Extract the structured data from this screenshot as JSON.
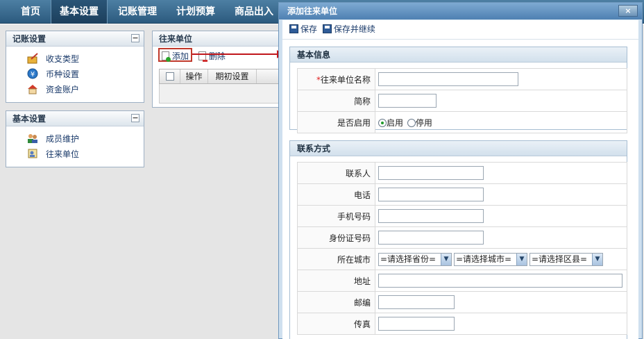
{
  "nav": {
    "tabs": [
      {
        "label": "首页"
      },
      {
        "label": "基本设置"
      },
      {
        "label": "记账管理"
      },
      {
        "label": "计划预算"
      },
      {
        "label": "商品出入"
      }
    ]
  },
  "sidebar": {
    "bookkeeping": {
      "title": "记账设置",
      "items": [
        {
          "label": "收支类型"
        },
        {
          "label": "币种设置"
        },
        {
          "label": "资金账户"
        }
      ]
    },
    "basic": {
      "title": "基本设置",
      "items": [
        {
          "label": "成员维护"
        },
        {
          "label": "往来单位"
        }
      ]
    },
    "collapse_label": "−"
  },
  "list": {
    "title": "往来单位",
    "add_label": "添加",
    "delete_label": "删除",
    "columns": [
      "操作",
      "期初设置"
    ]
  },
  "dialog": {
    "title": "添加往来单位",
    "close_label": "×",
    "save_label": "保存",
    "save_continue_label": "保存并继续",
    "basic_section": {
      "title": "基本信息",
      "required_mark": "*",
      "name_label": "往来单位名称",
      "short_label": "简称",
      "enabled_label": "是否启用",
      "enable_option": "启用",
      "disable_option": "停用"
    },
    "contact_section": {
      "title": "联系方式",
      "contact_label": "联系人",
      "phone_label": "电话",
      "mobile_label": "手机号码",
      "id_label": "身份证号码",
      "city_label": "所在城市",
      "province_select": "=请选择省份=",
      "city_select": "=请选择城市=",
      "district_select": "=请选择区县=",
      "address_label": "地址",
      "zip_label": "邮编",
      "fax_label": "传真"
    }
  }
}
